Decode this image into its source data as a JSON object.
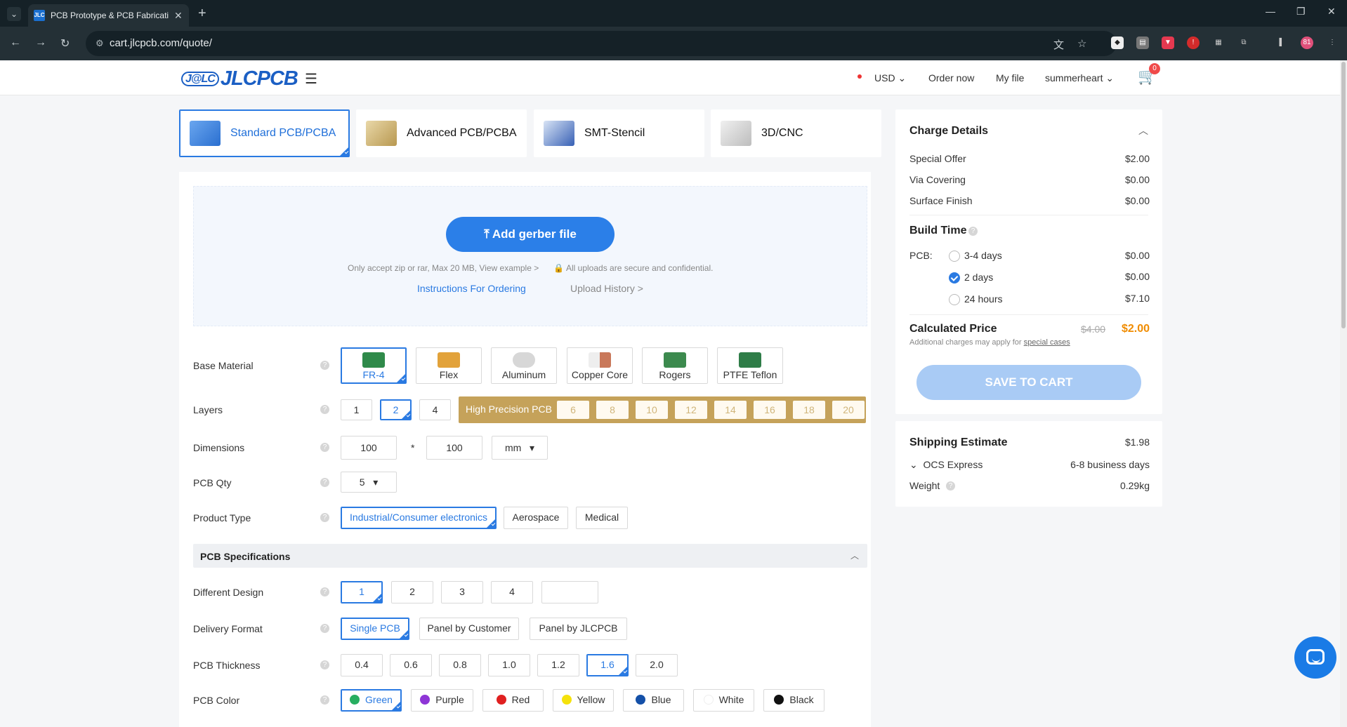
{
  "browser": {
    "tab_title": "PCB Prototype & PCB Fabricati",
    "favicon_text": "JLC",
    "url": "cart.jlcpcb.com/quote/"
  },
  "header": {
    "logo_badge": "J@LC",
    "logo_text": "JLCPCB",
    "currency": "USD",
    "order_now": "Order now",
    "my_file": "My file",
    "user": "summerheart",
    "cart_count": "0"
  },
  "product_tabs": [
    {
      "label": "Standard PCB/PCBA",
      "active": true
    },
    {
      "label": "Advanced PCB/PCBA",
      "active": false
    },
    {
      "label": "SMT-Stencil",
      "active": false
    },
    {
      "label": "3D/CNC",
      "active": false
    }
  ],
  "upload": {
    "button": "Add gerber file",
    "note": "Only accept zip or rar, Max 20 MB, View example >",
    "secure": "All uploads are secure and confidential.",
    "instructions": "Instructions For Ordering",
    "history": "Upload History >"
  },
  "form": {
    "base_material": {
      "label": "Base Material",
      "options": [
        "FR-4",
        "Flex",
        "Aluminum",
        "Copper Core",
        "Rogers",
        "PTFE Teflon"
      ],
      "selected": "FR-4"
    },
    "layers": {
      "label": "Layers",
      "options": [
        "1",
        "2",
        "4"
      ],
      "selected": "2",
      "hp_label": "High Precision PCB",
      "hp_options": [
        "6",
        "8",
        "10",
        "12",
        "14",
        "16",
        "18",
        "20"
      ]
    },
    "dimensions": {
      "label": "Dimensions",
      "width": "100",
      "sep": "*",
      "height": "100",
      "unit": "mm"
    },
    "qty": {
      "label": "PCB Qty",
      "value": "5"
    },
    "product_type": {
      "label": "Product Type",
      "options": [
        "Industrial/Consumer electronics",
        "Aerospace",
        "Medical"
      ],
      "selected": "Industrial/Consumer electronics"
    },
    "spec_section": "PCB Specifications",
    "different_design": {
      "label": "Different Design",
      "options": [
        "1",
        "2",
        "3",
        "4",
        ""
      ],
      "selected": "1"
    },
    "delivery_format": {
      "label": "Delivery Format",
      "options": [
        "Single PCB",
        "Panel by Customer",
        "Panel by JLCPCB"
      ],
      "selected": "Single PCB"
    },
    "thickness": {
      "label": "PCB Thickness",
      "options": [
        "0.4",
        "0.6",
        "0.8",
        "1.0",
        "1.2",
        "1.6",
        "2.0"
      ],
      "selected": "1.6"
    },
    "color": {
      "label": "PCB Color",
      "options": [
        {
          "name": "Green",
          "hex": "#27ae60"
        },
        {
          "name": "Purple",
          "hex": "#8e35d6"
        },
        {
          "name": "Red",
          "hex": "#e02020"
        },
        {
          "name": "Yellow",
          "hex": "#f5e20c"
        },
        {
          "name": "Blue",
          "hex": "#1450a8"
        },
        {
          "name": "White",
          "hex": "#ffffff"
        },
        {
          "name": "Black",
          "hex": "#111111"
        }
      ],
      "selected": "Green"
    }
  },
  "charge": {
    "title": "Charge Details",
    "lines": [
      {
        "label": "Special Offer",
        "value": "$2.00"
      },
      {
        "label": "Via Covering",
        "value": "$0.00"
      },
      {
        "label": "Surface Finish",
        "value": "$0.00"
      }
    ],
    "build_time_title": "Build Time",
    "pcb_label": "PCB:",
    "build_options": [
      {
        "label": "3-4 days",
        "value": "$0.00",
        "selected": false
      },
      {
        "label": "2 days",
        "value": "$0.00",
        "selected": true
      },
      {
        "label": "24 hours",
        "value": "$7.10",
        "selected": false
      }
    ],
    "calc_title": "Calculated Price",
    "old_price": "$4.00",
    "price": "$2.00",
    "additional": "Additional charges may apply for",
    "special_cases": "special cases",
    "save_button": "SAVE TO CART"
  },
  "shipping": {
    "title": "Shipping Estimate",
    "amount": "$1.98",
    "method": "OCS Express",
    "days": "6-8 business days",
    "weight_label": "Weight",
    "weight": "0.29kg"
  },
  "colors": {
    "accent": "#2a7ae2",
    "price": "#f08c00",
    "hp_gold": "#c5a25a"
  }
}
